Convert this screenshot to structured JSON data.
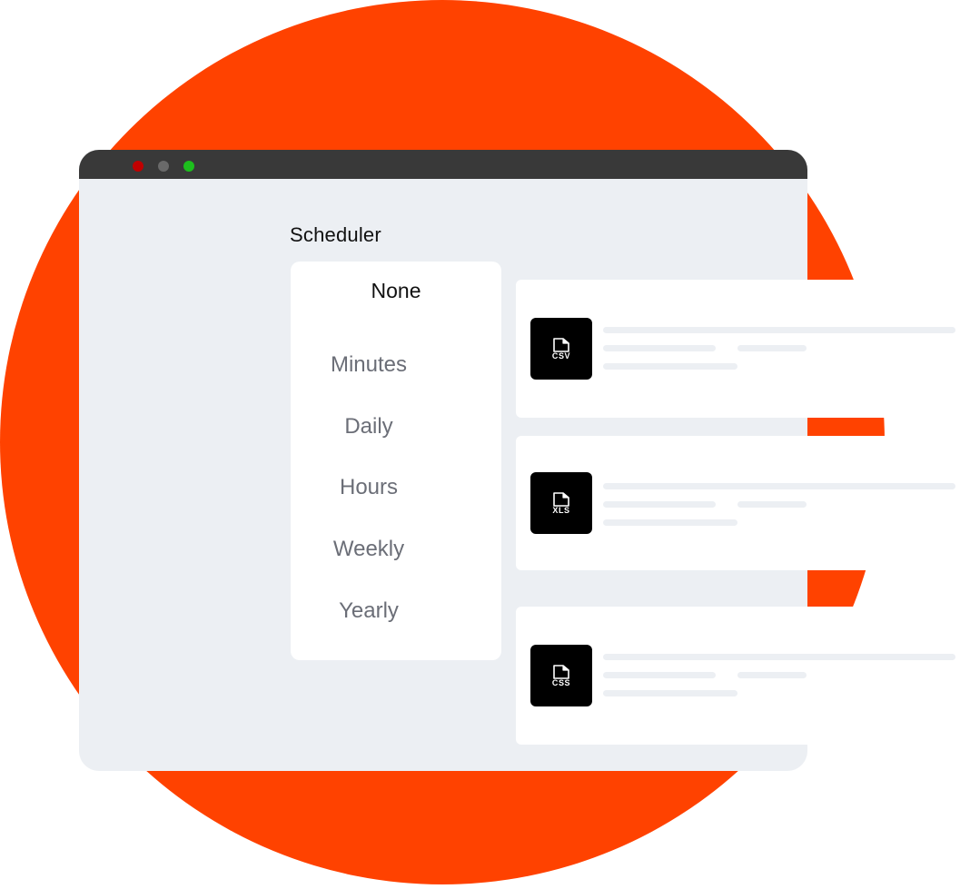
{
  "colors": {
    "accent": "#ff4200",
    "window_bg": "#eceff3",
    "titlebar": "#393939",
    "dot_red": "#c00000",
    "dot_gray": "#6a6a6a",
    "dot_green": "#1dbf1d"
  },
  "scheduler": {
    "title": "Scheduler",
    "selected": "None",
    "options": [
      "Minutes",
      "Daily",
      "Hours",
      "Weekly",
      "Yearly"
    ]
  },
  "files": [
    {
      "type": "CSV",
      "icon": "file-icon"
    },
    {
      "type": "XLS",
      "icon": "file-icon"
    },
    {
      "type": "CSS",
      "icon": "file-icon"
    }
  ]
}
